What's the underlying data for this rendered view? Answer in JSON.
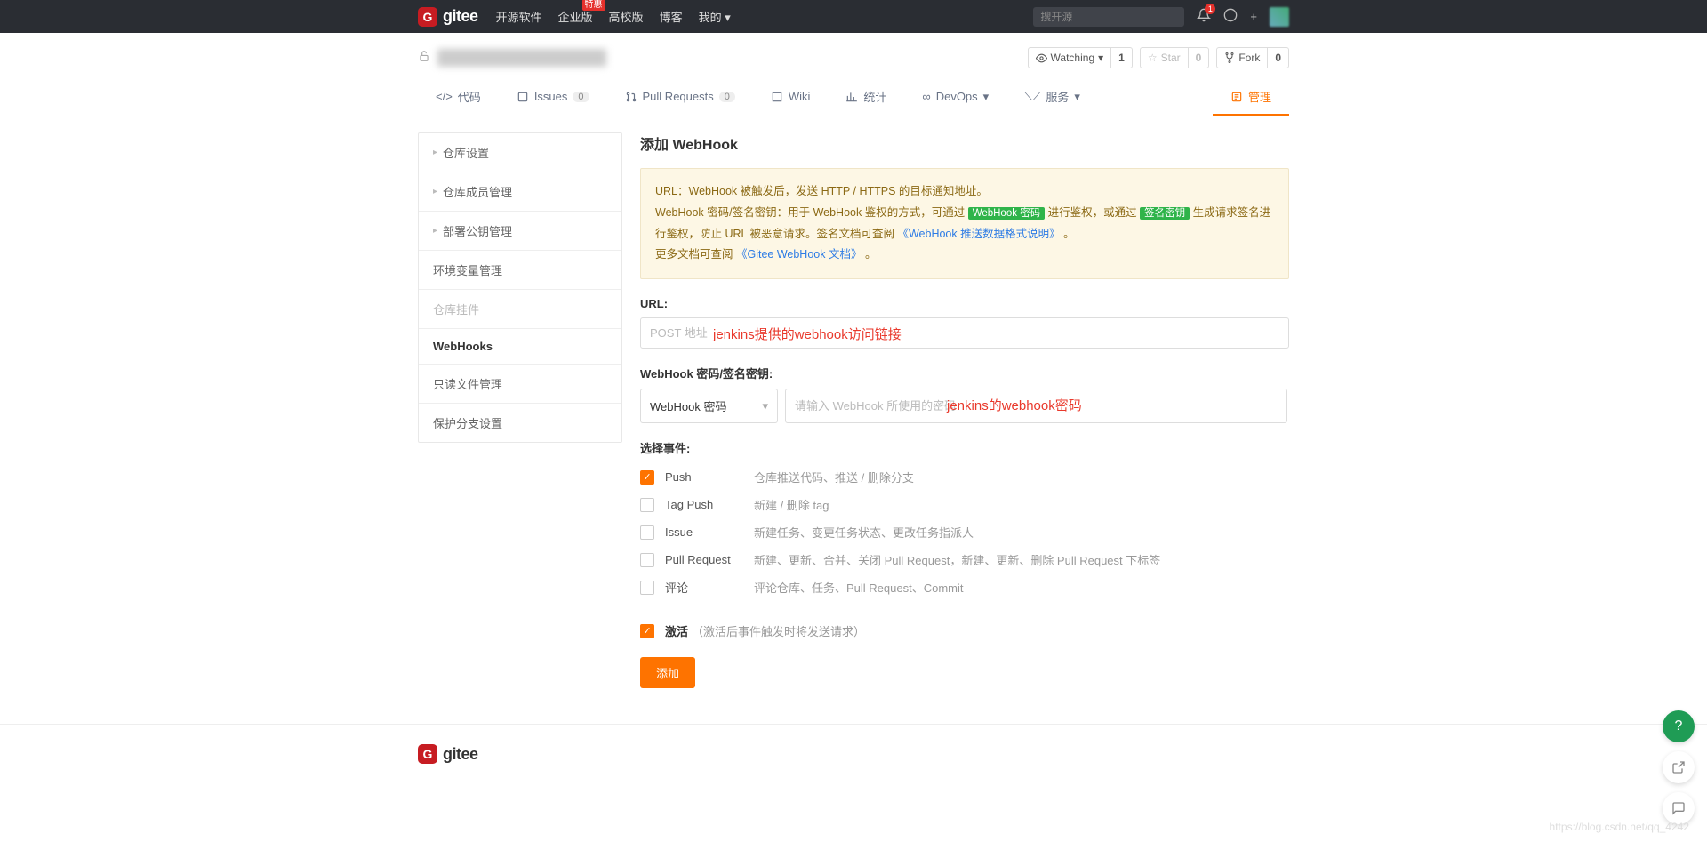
{
  "topnav": {
    "logo": "gitee",
    "links": {
      "opensource": "开源软件",
      "enterprise": "企业版",
      "enterprise_badge": "特惠",
      "campus": "高校版",
      "blog": "博客",
      "mine": "我的"
    },
    "search_placeholder": "搜开源",
    "notif_count": "1"
  },
  "repo": {
    "watch": "Watching",
    "watch_count": "1",
    "star": "Star",
    "star_count": "0",
    "fork": "Fork",
    "fork_count": "0"
  },
  "tabs": {
    "code": "代码",
    "issues": "Issues",
    "issues_count": "0",
    "pr": "Pull Requests",
    "pr_count": "0",
    "wiki": "Wiki",
    "stats": "统计",
    "devops": "DevOps",
    "services": "服务",
    "manage": "管理"
  },
  "sidebar": {
    "repo_settings": "仓库设置",
    "members": "仓库成员管理",
    "deploy_keys": "部署公钥管理",
    "env_vars": "环境变量管理",
    "plugins": "仓库挂件",
    "webhooks": "WebHooks",
    "readonly": "只读文件管理",
    "branch_protect": "保护分支设置"
  },
  "page": {
    "title": "添加 WebHook",
    "notice_line1": "URL：WebHook 被触发后，发送 HTTP / HTTPS 的目标通知地址。",
    "notice_line2a": "WebHook 密码/签名密钥：用于 WebHook 鉴权的方式，可通过 ",
    "notice_tag1": "WebHook 密码",
    "notice_line2b": " 进行鉴权，或通过 ",
    "notice_tag2": "签名密钥",
    "notice_line2c": " 生成请求签名进行鉴权，防止 URL 被恶意请求。签名文档可查阅 ",
    "notice_link1": "《WebHook 推送数据格式说明》",
    "notice_dot": " 。",
    "notice_line3a": "更多文档可查阅 ",
    "notice_link2": "《Gitee WebHook 文档》",
    "url_label": "URL:",
    "url_placeholder": "POST 地址",
    "url_anno": "jenkins提供的webhook访问链接",
    "secret_label": "WebHook 密码/签名密钥:",
    "secret_select": "WebHook 密码",
    "secret_placeholder": "请输入 WebHook 所使用的密码",
    "secret_anno": "jenkins的webhook密码",
    "events_label": "选择事件:",
    "events": [
      {
        "name": "Push",
        "desc": "仓库推送代码、推送 / 删除分支",
        "checked": true
      },
      {
        "name": "Tag Push",
        "desc": "新建 / 删除 tag",
        "checked": false
      },
      {
        "name": "Issue",
        "desc": "新建任务、变更任务状态、更改任务指派人",
        "checked": false
      },
      {
        "name": "Pull Request",
        "desc": "新建、更新、合并、关闭 Pull Request，新建、更新、删除 Pull Request 下标签",
        "checked": false
      },
      {
        "name": "评论",
        "desc": "评论仓库、任务、Pull Request、Commit",
        "checked": false
      }
    ],
    "activate": "激活",
    "activate_desc": "（激活后事件触发时将发送请求）",
    "submit": "添加"
  },
  "footer": {
    "logo": "gitee"
  },
  "watermark": "https://blog.csdn.net/qq_4242"
}
